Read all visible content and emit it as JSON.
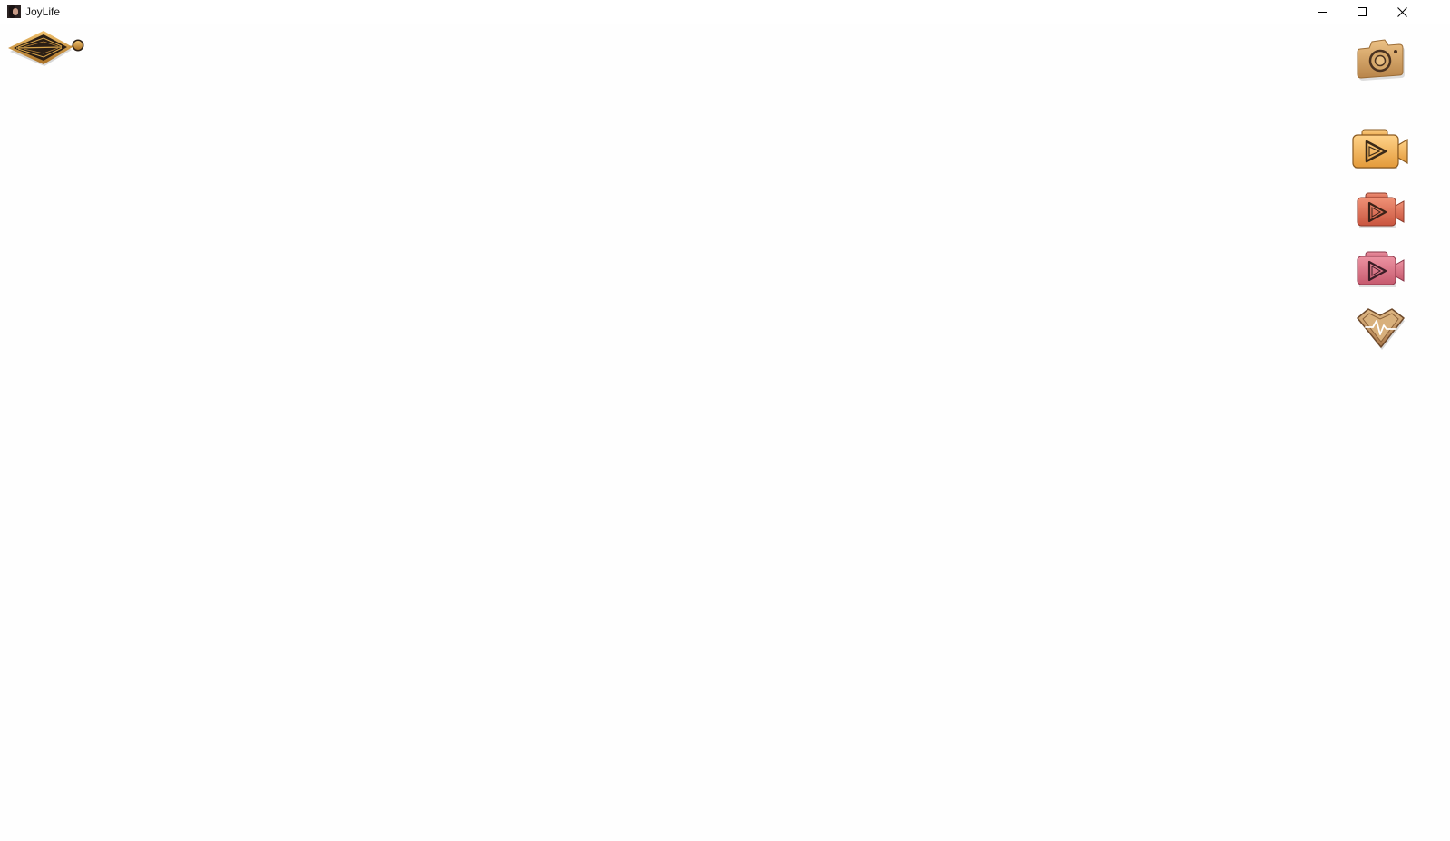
{
  "window": {
    "title": "JoyLife",
    "controls": {
      "minimize": "minimize-icon",
      "maximize": "maximize-icon",
      "close": "close-icon"
    }
  },
  "toolbar": {
    "back": {
      "icon": "back-arrow-icon",
      "color": "#2b1f15",
      "accent": "#d9a54a"
    },
    "buttons": [
      {
        "name": "camera-button",
        "icon": "camera-icon",
        "color": "#d5a15c"
      },
      {
        "name": "video-button-gold",
        "icon": "video-camera-icon",
        "color": "#f3b251"
      },
      {
        "name": "video-button-orange",
        "icon": "video-camera-icon",
        "color": "#e0735a"
      },
      {
        "name": "video-button-pink",
        "icon": "video-camera-icon",
        "color": "#d96a7e"
      },
      {
        "name": "heart-rate-button",
        "icon": "heart-rate-icon",
        "color": "#c9a06a"
      }
    ]
  }
}
